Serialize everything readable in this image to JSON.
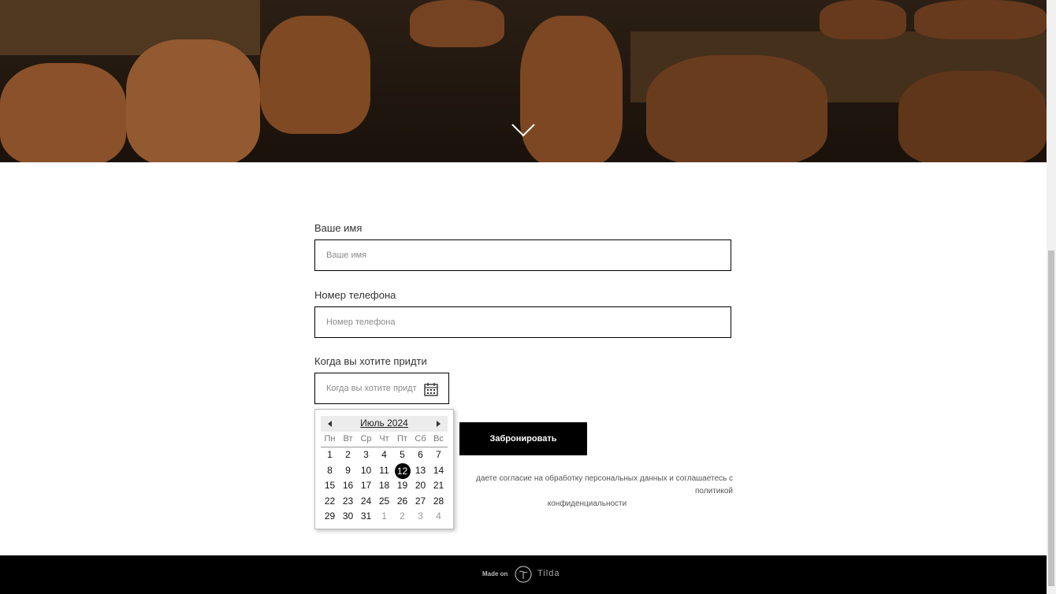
{
  "form": {
    "name_label": "Ваше имя",
    "name_placeholder": "Ваше имя",
    "phone_label": "Номер телефона",
    "phone_placeholder": "Номер телефона",
    "date_label": "Когда вы хотите придти",
    "date_placeholder": "Когда вы хотите придти",
    "submit_label": "Забронировать",
    "consent_line1": "даете согласие на обработку персональных данных и соглашаетесь c политикой",
    "consent_line2": "конфиденциальности"
  },
  "datepicker": {
    "month": "Июль",
    "year": "2024",
    "weekdays": [
      "Пн",
      "Вт",
      "Ср",
      "Чт",
      "Пт",
      "Сб",
      "Вс"
    ],
    "weeks": [
      [
        "1",
        "2",
        "3",
        "4",
        "5",
        "6",
        "7"
      ],
      [
        "8",
        "9",
        "10",
        "11",
        "12",
        "13",
        "14"
      ],
      [
        "15",
        "16",
        "17",
        "18",
        "19",
        "20",
        "21"
      ],
      [
        "22",
        "23",
        "24",
        "25",
        "26",
        "27",
        "28"
      ],
      [
        "29",
        "30",
        "31",
        "1",
        "2",
        "3",
        "4"
      ]
    ],
    "selected": "12"
  },
  "footer": {
    "made_on": "Made on",
    "brand": "Tilda"
  },
  "colors": {
    "accent": "#000000",
    "footer_bg": "#000000"
  },
  "icons": {
    "hero_arrow": "chevron-down-icon",
    "calendar": "calendar-icon",
    "prev": "arrow-left-icon",
    "next": "arrow-right-icon",
    "tilda": "tilda-logo-icon"
  }
}
